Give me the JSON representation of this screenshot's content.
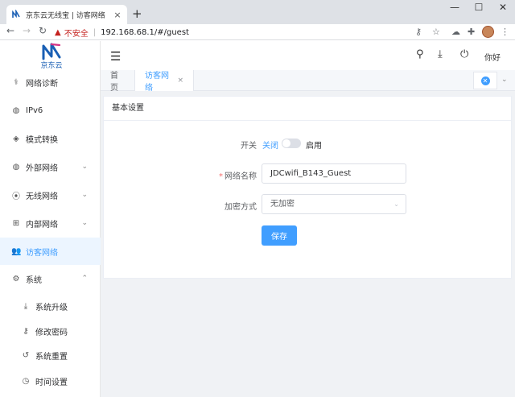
{
  "browser": {
    "tab_title": "京东云无线宝 | 访客网络",
    "tab_close": "×",
    "new_tab": "+",
    "insecure_label": "不安全",
    "url_sep": "|",
    "url": "192.168.68.1/#/guest",
    "minimize": "—",
    "maximize": "☐",
    "close": "✕"
  },
  "sidebar": {
    "brand": "京东云",
    "items": [
      {
        "label": "网络诊断",
        "icon": "stethoscope-icon",
        "glyph": "⚕"
      },
      {
        "label": "IPv6",
        "icon": "globe-icon",
        "glyph": "◍"
      },
      {
        "label": "模式转换",
        "icon": "cube-icon",
        "glyph": "◈"
      },
      {
        "label": "外部网络",
        "icon": "globe-icon",
        "glyph": "◍",
        "chevron": "⌄"
      },
      {
        "label": "无线网络",
        "icon": "wifi-icon",
        "glyph": "⦿",
        "chevron": "⌄"
      },
      {
        "label": "内部网络",
        "icon": "sitemap-icon",
        "glyph": "⊞",
        "chevron": "⌄"
      },
      {
        "label": "访客网络",
        "icon": "users-icon",
        "glyph": "👥",
        "active": true
      },
      {
        "label": "系统",
        "icon": "cogs-icon",
        "glyph": "⚙",
        "chevron": "⌃"
      },
      {
        "label": "系统升级",
        "icon": "download-icon",
        "glyph": "⤓"
      },
      {
        "label": "修改密码",
        "icon": "key-icon",
        "glyph": "⚷"
      },
      {
        "label": "系统重置",
        "icon": "undo-icon",
        "glyph": "↺"
      },
      {
        "label": "时间设置",
        "icon": "clock-icon",
        "glyph": "◷"
      }
    ]
  },
  "header": {
    "greeting": "你好",
    "menu_glyph": "☰"
  },
  "tabs": {
    "home": "首页",
    "current": "访客网络",
    "current_close": "×"
  },
  "form": {
    "section_title": "基本设置",
    "switch_label": "开关",
    "switch_off": "关闭",
    "switch_on": "启用",
    "switch_enabled": false,
    "ssid_label": "网络名称",
    "required_mark": "*",
    "ssid_value": "JDCwifi_B143_Guest",
    "encryption_label": "加密方式",
    "encryption_value": "无加密",
    "save_label": "保存"
  },
  "colors": {
    "accent": "#409eff",
    "active_bg": "#ecf5ff",
    "insecure": "#c5221f",
    "content_bg": "#f0f2f5"
  }
}
